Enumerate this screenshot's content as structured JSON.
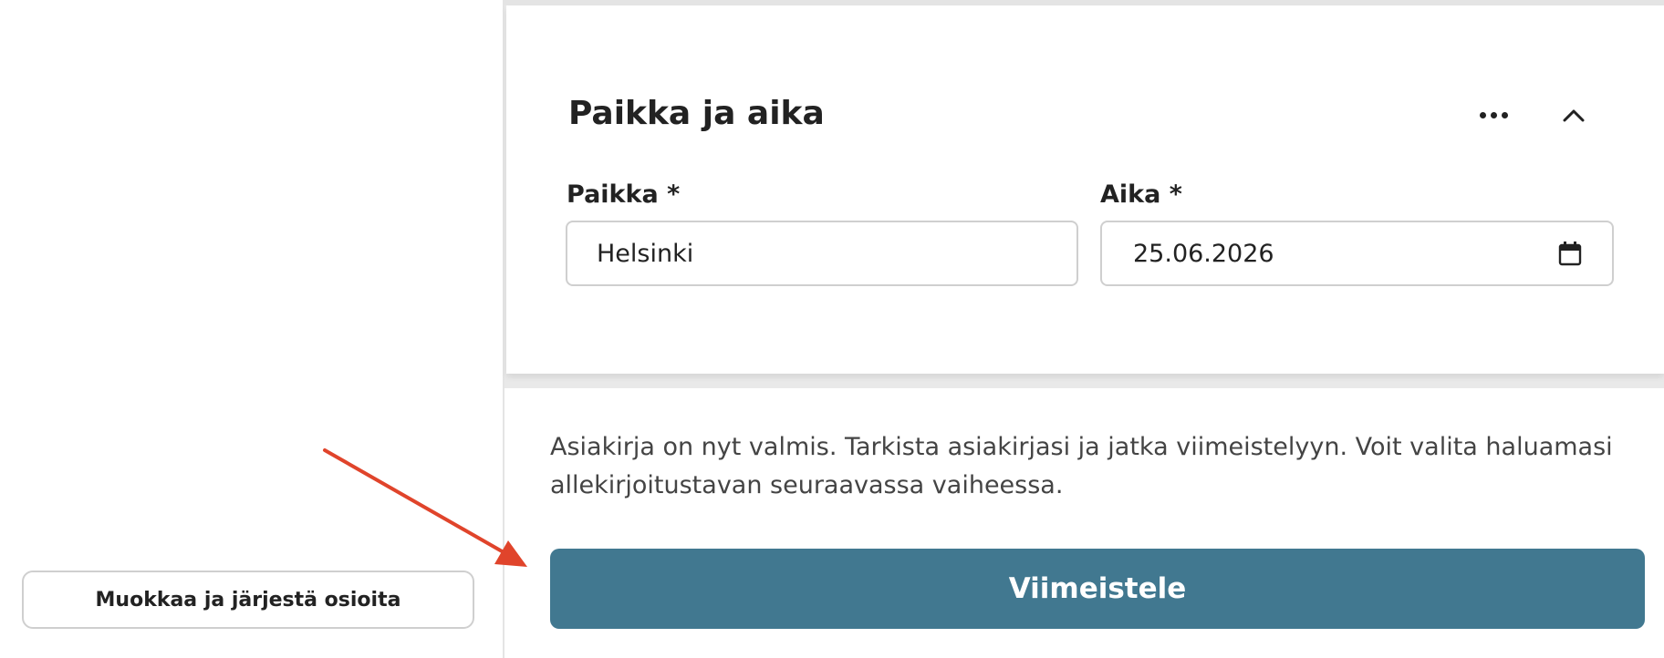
{
  "sidebar": {
    "edit_sections_label": "Muokkaa ja järjestä osioita"
  },
  "section": {
    "title": "Paikka ja aika",
    "more_icon": "more-horizontal-icon",
    "collapse_icon": "chevron-up-icon"
  },
  "fields": {
    "place": {
      "label": "Paikka *",
      "value": "Helsinki"
    },
    "time": {
      "label": "Aika *",
      "value": "25.06.2026",
      "icon": "calendar-icon"
    }
  },
  "footer": {
    "info": "Asiakirja on nyt valmis. Tarkista asiakirjasi ja jatka viimeistelyyn. Voit valita haluamasi allekirjoitustavan seuraavassa vaiheessa.",
    "finalize_label": "Viimeistele"
  },
  "colors": {
    "primary_button": "#417890",
    "annotation_arrow": "#e0442b"
  }
}
